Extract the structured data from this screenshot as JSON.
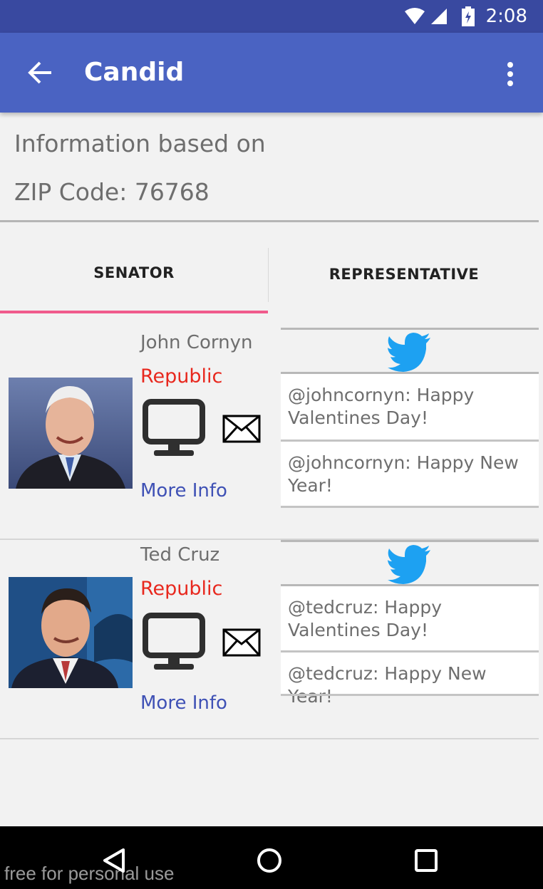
{
  "status_bar": {
    "time": "2:08",
    "icons": [
      "wifi-icon",
      "signal-icon",
      "battery-icon"
    ]
  },
  "app_bar": {
    "title": "Candid",
    "back_icon": "arrow-back-icon",
    "menu_icon": "more-vert-icon"
  },
  "info": {
    "line1": "Information based on",
    "line2": "ZIP Code: 76768"
  },
  "tabs": [
    {
      "label": "SENATOR",
      "selected": true
    },
    {
      "label": "REPRESENTATIVE",
      "selected": false
    }
  ],
  "colors": {
    "status_bar": "#3949a0",
    "app_bar": "#4a63c2",
    "tab_indicator": "#f05b8c",
    "party_red": "#e8281e",
    "link_blue": "#3f51b5",
    "twitter_blue": "#1da1f2"
  },
  "legislators": [
    {
      "name": "John Cornyn",
      "party": "Republic",
      "more_info": "More Info",
      "tweets": [
        "@johncornyn: Happy Valentines Day!",
        "@johncornyn: Happy New Year!"
      ]
    },
    {
      "name": "Ted Cruz",
      "party": "Republic",
      "more_info": "More Info",
      "tweets": [
        "@tedcruz: Happy Valentines Day!",
        "@tedcruz: Happy New Year!"
      ]
    }
  ],
  "nav": {
    "back_icon": "nav-back-icon",
    "home_icon": "nav-home-icon",
    "recents_icon": "nav-recents-icon"
  },
  "watermark": "free for personal use"
}
